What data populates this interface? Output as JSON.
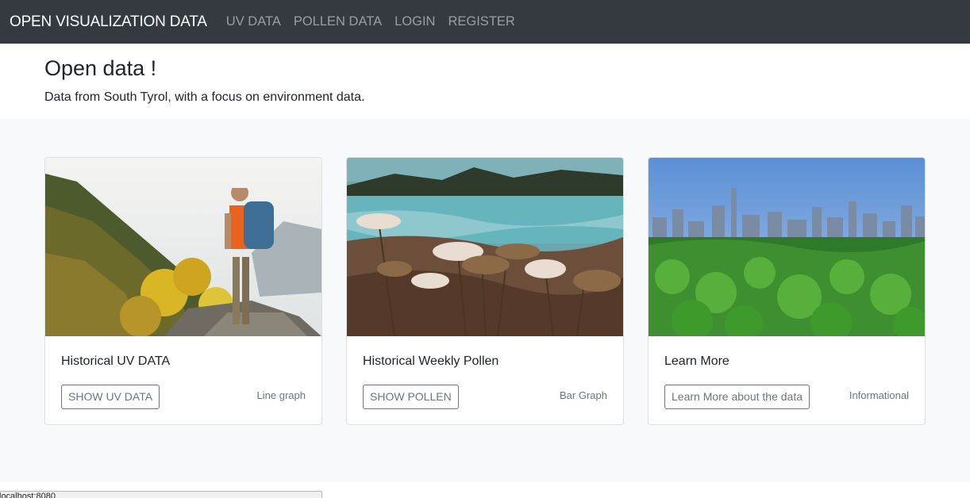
{
  "navbar": {
    "brand": "OPEN VISUALIZATION DATA",
    "links": [
      "UV DATA",
      "POLLEN DATA",
      "LOGIN",
      "REGISTER"
    ]
  },
  "hero": {
    "title": "Open data !",
    "subtitle": "Data from South Tyrol, with a focus on environment data."
  },
  "cards": [
    {
      "title": "Historical UV DATA",
      "button": "SHOW UV DATA",
      "meta": "Line graph",
      "image": "hiker-on-mountain-photo"
    },
    {
      "title": "Historical Weekly Pollen",
      "button": "SHOW POLLEN",
      "meta": "Bar Graph",
      "image": "wildflowers-by-lake-photo"
    },
    {
      "title": "Learn More",
      "button": "Learn More about the data",
      "meta": "Informational",
      "image": "green-field-city-skyline-photo"
    }
  ],
  "statusbar": {
    "url": "localhost:8080"
  },
  "colors": {
    "navbar_bg": "#343a40",
    "section_bg": "#f8f9fa",
    "button_border": "#6c757d"
  }
}
